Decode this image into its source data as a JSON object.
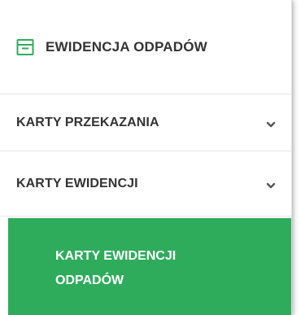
{
  "header": {
    "icon": "archive-box-icon",
    "title": "EWIDENCJA ODPADÓW",
    "accent_color": "#2eac5c"
  },
  "menu": {
    "items": [
      {
        "label": "KARTY PRZEKAZANIA",
        "icon": "chevron-down-icon",
        "expanded": false
      },
      {
        "label": "KARTY EWIDENCJI",
        "icon": "chevron-down-icon",
        "expanded": true
      }
    ],
    "active_subitem": {
      "label": "KARTY EWIDENCJI ODPADÓW",
      "background_color": "#2eac5c",
      "text_color": "#ffffff"
    }
  }
}
